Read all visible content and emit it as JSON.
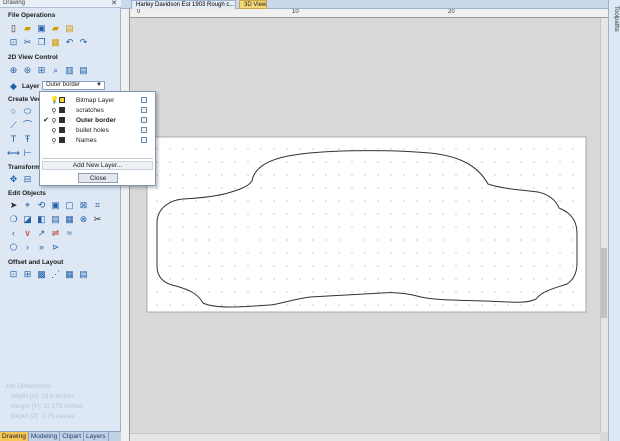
{
  "panel": {
    "title": "Drawing",
    "pin": "✕"
  },
  "sections": {
    "file_ops": "File Operations",
    "view_control": "2D View Control",
    "create_vectors": "Create Vect",
    "transform": "Transform O",
    "edit_objects": "Edit Objects",
    "offset_layout": "Offset and Layout"
  },
  "layer": {
    "label": "Layer",
    "selected": "Outer border"
  },
  "layers_popup": {
    "layers": [
      {
        "name": "Bitmap Layer",
        "bold": false,
        "checked": false,
        "color": "#f2d33b"
      },
      {
        "name": "scratches",
        "bold": false,
        "checked": false,
        "color": "#2d2d2d"
      },
      {
        "name": "Outer border",
        "bold": true,
        "checked": true,
        "color": "#2d2d2d"
      },
      {
        "name": "bullet holes",
        "bold": false,
        "checked": false,
        "color": "#2d2d2d"
      },
      {
        "name": "Names",
        "bold": false,
        "checked": false,
        "color": "#2d2d2d"
      }
    ],
    "add_label": "Add New Layer...",
    "close_label": "Close"
  },
  "job": {
    "heading": "Job Dimensions",
    "width": "Width  [X]: 28.8 inches",
    "height": "Height [Y]: 11.175 inches",
    "depth": "Depth  [Z]: 0.75 inches"
  },
  "bottom_tabs": [
    "Drawing",
    "Modeling",
    "Clipart",
    "Layers"
  ],
  "doc_tabs": {
    "file": "Harley Davidson Est 1903 Rough c...",
    "view3d": "3D View"
  },
  "right_panel": {
    "label": "Toolpaths"
  },
  "ruler": {
    "top_ticks": [
      "0",
      "10",
      "20"
    ]
  },
  "icons": {
    "file_ops": [
      "new-file-icon",
      "open-folder-icon",
      "save-icon",
      "save-as-icon",
      "import-icon",
      "cut-icon",
      "copy-icon",
      "paste-icon",
      "undo-icon",
      "redo-icon"
    ],
    "view_control": [
      "zoom-all-icon",
      "zoom-in-icon",
      "zoom-box-icon",
      "pan-icon",
      "view-layout-icon",
      "view-2d-icon"
    ],
    "colors": {
      "accent": "#1f5fa8",
      "active_tab": "#f6c659",
      "panel_bg": "#dde8f4"
    }
  }
}
